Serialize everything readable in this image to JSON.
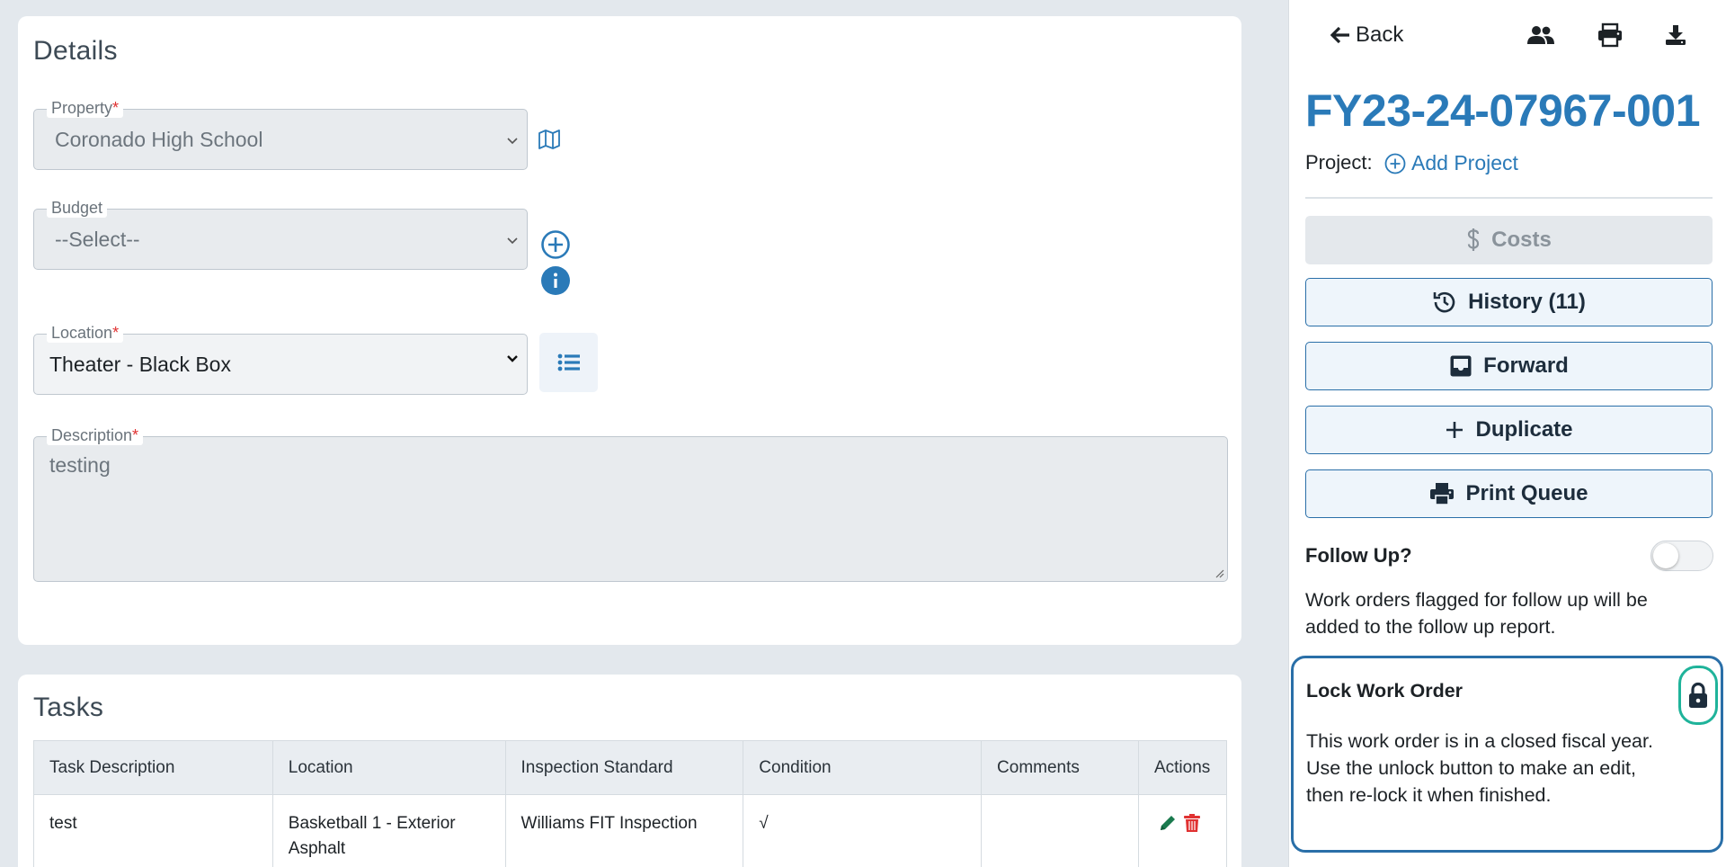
{
  "details": {
    "title": "Details",
    "property": {
      "label": "Property",
      "required_mark": "*",
      "value": "Coronado High School"
    },
    "budget": {
      "label": "Budget",
      "value": "--Select--"
    },
    "location": {
      "label": "Location",
      "required_mark": "*",
      "value": "Theater - Black Box"
    },
    "description": {
      "label": "Description",
      "required_mark": "*",
      "value": "testing"
    }
  },
  "tasks": {
    "title": "Tasks",
    "columns": [
      "Task Description",
      "Location",
      "Inspection Standard",
      "Condition",
      "Comments",
      "Actions"
    ],
    "rows": [
      {
        "task_description": "test",
        "location": "Basketball 1 - Exterior Asphalt",
        "inspection_standard": "Williams FIT Inspection",
        "condition": "√",
        "comments": ""
      }
    ]
  },
  "panel": {
    "back_label": "Back",
    "work_order_id": "FY23-24-07967-001",
    "project_label": "Project:",
    "add_project_label": "Add Project",
    "buttons": {
      "costs": "Costs",
      "history": "History (11)",
      "forward": "Forward",
      "duplicate": "Duplicate",
      "print_queue": "Print Queue"
    },
    "follow_up": {
      "label": "Follow Up?",
      "enabled": false,
      "text": "Work orders flagged for follow up will be added to the follow up report."
    },
    "lock": {
      "title": "Lock Work Order",
      "text": "This work order is in a closed fiscal year. Use the unlock button to make an edit, then re-lock it when finished."
    }
  },
  "colors": {
    "accent_blue": "#2a7ab8",
    "lock_border": "#2a6fa8",
    "lock_button_border": "#1fb39a",
    "delete_red": "#e03131",
    "edit_green": "#1a7a4e"
  }
}
